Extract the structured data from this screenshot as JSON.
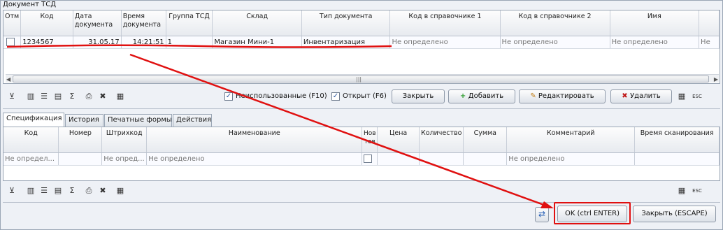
{
  "section_title": "Документ ТСД",
  "doc_columns": [
    "Отм",
    "Код",
    "Дата документа",
    "Время документа",
    "Группа ТСД",
    "Склад",
    "Тип документа",
    "Код в справочнике 1",
    "Код в справочнике 2",
    "Имя"
  ],
  "doc_row": {
    "code": "1234567",
    "date": "31.05.17",
    "time": "14:21:51",
    "group": "1",
    "warehouse": "Магазин Мини-1",
    "doc_type": "Инвентаризация",
    "ref1": "Не определено",
    "ref2": "Не определено",
    "name": "Не определено",
    "extra": "Не"
  },
  "toolbar1": {
    "unused_label": "Неиспользованные (F10)",
    "open_label": "Открыт (F6)",
    "close_btn": "Закрыть",
    "add_btn": "Добавить",
    "edit_btn": "Редактировать",
    "delete_btn": "Удалить"
  },
  "tabs": [
    "Спецификация",
    "История",
    "Печатные формы",
    "Действия"
  ],
  "spec_columns": [
    "Код",
    "Номер",
    "Штрихкод",
    "Наименование",
    "Нов тов",
    "Цена",
    "Количество",
    "Сумма",
    "Комментарий",
    "Время сканирования"
  ],
  "spec_row": {
    "code": "Не определ...",
    "barcode": "Не опред...",
    "name": "Не определено",
    "comment": "Не определено"
  },
  "footer": {
    "ok_btn": "OK (ctrl ENTER)",
    "close_btn": "Закрыть (ESCAPE)"
  },
  "colors": {
    "annotation": "#e01010"
  }
}
